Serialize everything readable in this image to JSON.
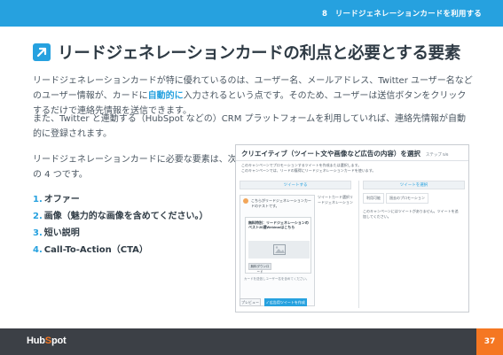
{
  "header": {
    "chapter": "8　リードジェネレーションカードを利用する"
  },
  "title": "リードジェネレーションカードの利点と必要とする要素",
  "para1": {
    "before": "リードジェネレーションカードが特に優れているのは、ユーザー名、メールアドレス、Twitter ユーザー名などのユーザー情報が、カードに",
    "highlight": "自動的に",
    "after": "入力されるという点です。そのため、ユーザーは送信ボタンをクリックするだけで連絡先情報を送信できます。"
  },
  "para2": "また、Twitter と連動する（HubSpot などの）CRM プラットフォームを利用していれば、連絡先情報が自動的に登録されます。",
  "intro": "リードジェネレーションカードに必要な要素は、次の 4 つです。",
  "list": [
    {
      "num": "1.",
      "label": "オファー"
    },
    {
      "num": "2.",
      "label": "画像（魅力的な画像を含めてください。）"
    },
    {
      "num": "3.",
      "label": "短い説明"
    },
    {
      "num": "4.",
      "label": "Call-To-Action（CTA）"
    }
  ],
  "screenshot": {
    "title": "クリエイティブ（ツイート文や画像など広告の内容）を選択",
    "step": "ステップ 5/6",
    "desc1": "このキャンペーンでプロモーションするツイートを作成または選択します。",
    "desc2": "このキャンペーンでは、リードの獲得にリードジェネレーションカードを使います。",
    "tab_left": "ツイートする",
    "tab_right": "ツイートを選択",
    "right_tabs": [
      "利用可能",
      "過去のプロモーション"
    ],
    "right_note": "このキャンペーンにはツイートがありません。ツイートを追加してください。",
    "card_text": "こちらがリードジェネレーションカードのテストです。",
    "card_inner_title": "無料特別：リードジェネレーションのベスト20選Webinarはこちら",
    "card_cta": "無料ダウンロード",
    "card_foot": "カードを送信しユーザー名を含めてください。",
    "mid_col": "ツイートカード選択リードジェネレーション",
    "btn_preview": "プレビュー",
    "btn_submit": "✓ 広告用ツイートを作成"
  },
  "footer": {
    "logo_a": "Hub",
    "logo_o": "S",
    "logo_b": "pot",
    "page": "37"
  },
  "colors": {
    "accent": "#26a1df",
    "orange": "#f57722",
    "footer_bg": "#3c4046"
  }
}
